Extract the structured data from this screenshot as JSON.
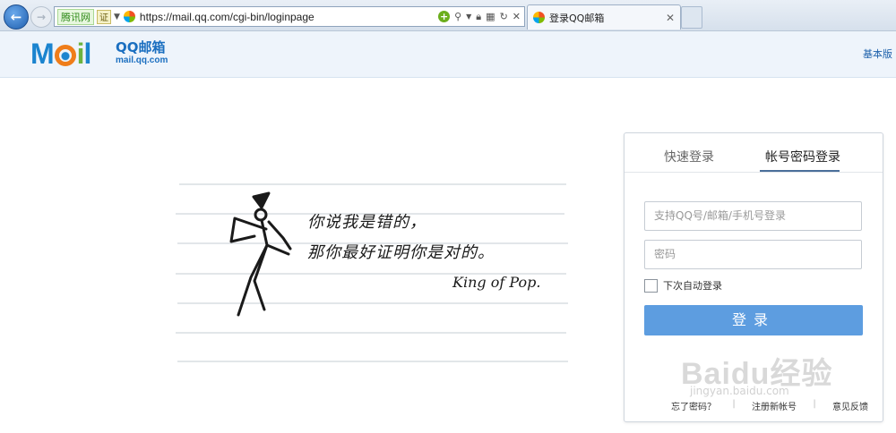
{
  "browser": {
    "address_site_label": "腾讯网",
    "address_cert_label": "证",
    "url": "https://mail.qq.com/cgi-bin/loginpage",
    "tab_title": "登录QQ邮箱"
  },
  "header": {
    "logo_letters": [
      "M",
      "o",
      "i",
      "l"
    ],
    "logo_title": "QQ邮箱",
    "logo_domain": "mail.qq.com",
    "basic_version_link": "基本版"
  },
  "illustration": {
    "line1": "你说我是错的，",
    "line2": "那你最好证明你是对的。",
    "signature": "King of Pop."
  },
  "login": {
    "tab_quick": "快速登录",
    "tab_account": "帐号密码登录",
    "username_placeholder": "支持QQ号/邮箱/手机号登录",
    "password_placeholder": "密码",
    "remember_label": "下次自动登录",
    "login_button": "登录",
    "links": {
      "forgot": "忘了密码？",
      "register": "注册新帐号",
      "feedback": "意见反馈"
    }
  },
  "watermark": {
    "text": "Baidu经验",
    "url": "jingyan.baidu.com"
  },
  "colors": {
    "accent": "#5d9de0",
    "brand_blue": "#1b84cf",
    "brand_orange": "#ef7d1a",
    "brand_green": "#6cb33f"
  }
}
